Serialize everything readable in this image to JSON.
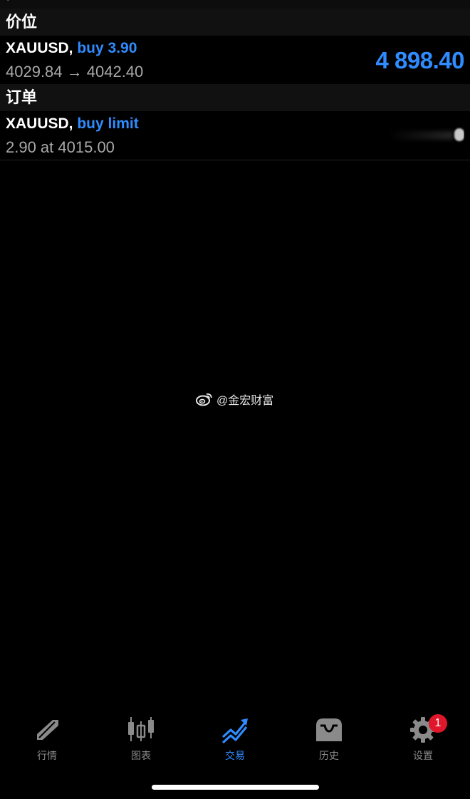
{
  "positions": {
    "header": "价位",
    "item": {
      "symbol": "XAUUSD,",
      "side": "buy 3.90",
      "price_change": "4029.84 → 4042.40",
      "current_price": "4 898.40"
    }
  },
  "orders": {
    "header": "订单",
    "item": {
      "symbol": "XAUUSD,",
      "side": "buy limit",
      "details": "2.90 at 4015.00"
    }
  },
  "watermark": {
    "text": "@金宏财富",
    "icon": "weibo-icon"
  },
  "tabs": [
    {
      "label": "行情",
      "icon": "quotes-arrow-icon",
      "active": false
    },
    {
      "label": "图表",
      "icon": "candlestick-icon",
      "active": false
    },
    {
      "label": "交易",
      "icon": "trade-trend-icon",
      "active": true
    },
    {
      "label": "历史",
      "icon": "inbox-history-icon",
      "active": false
    },
    {
      "label": "设置",
      "icon": "gear-icon",
      "active": false,
      "badge": "1"
    }
  ],
  "colors": {
    "accent": "#2f8cff",
    "badge": "#e0162b",
    "inactive": "#8a8a8a"
  }
}
